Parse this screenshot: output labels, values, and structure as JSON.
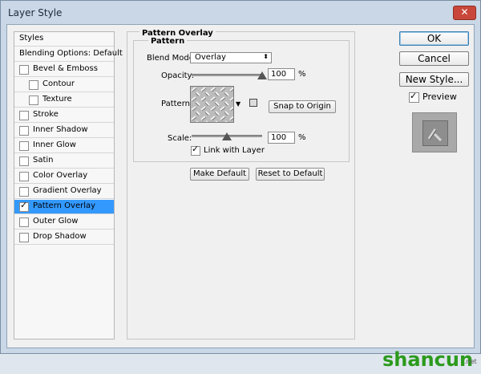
{
  "window": {
    "title": "Layer Style",
    "close_glyph": "✕"
  },
  "styles_list": {
    "items": [
      {
        "label": "Styles",
        "checkbox": false,
        "checked": false,
        "indent": 0
      },
      {
        "label": "Blending Options: Default",
        "checkbox": false,
        "checked": false,
        "indent": 0
      },
      {
        "label": "Bevel & Emboss",
        "checkbox": true,
        "checked": false,
        "indent": 0
      },
      {
        "label": "Contour",
        "checkbox": true,
        "checked": false,
        "indent": 1
      },
      {
        "label": "Texture",
        "checkbox": true,
        "checked": false,
        "indent": 1
      },
      {
        "label": "Stroke",
        "checkbox": true,
        "checked": false,
        "indent": 0
      },
      {
        "label": "Inner Shadow",
        "checkbox": true,
        "checked": false,
        "indent": 0
      },
      {
        "label": "Inner Glow",
        "checkbox": true,
        "checked": false,
        "indent": 0
      },
      {
        "label": "Satin",
        "checkbox": true,
        "checked": false,
        "indent": 0
      },
      {
        "label": "Color Overlay",
        "checkbox": true,
        "checked": false,
        "indent": 0
      },
      {
        "label": "Gradient Overlay",
        "checkbox": true,
        "checked": false,
        "indent": 0
      },
      {
        "label": "Pattern Overlay",
        "checkbox": true,
        "checked": true,
        "indent": 0,
        "selected": true
      },
      {
        "label": "Outer Glow",
        "checkbox": true,
        "checked": false,
        "indent": 0
      },
      {
        "label": "Drop Shadow",
        "checkbox": true,
        "checked": false,
        "indent": 0
      }
    ]
  },
  "panel": {
    "group_title": "Pattern Overlay",
    "subgroup_title": "Pattern",
    "blend_mode_label": "Blend Mode:",
    "blend_mode_value": "Overlay",
    "opacity_label": "Opacity:",
    "opacity_value": "100",
    "opacity_unit": "%",
    "opacity_level": 1.0,
    "pattern_label": "Pattern:",
    "snap_button": "Snap to Origin",
    "scale_label": "Scale:",
    "scale_value": "100",
    "scale_unit": "%",
    "link_label": "Link with Layer",
    "link_checked": true,
    "make_default_button": "Make Default",
    "reset_default_button": "Reset to Default"
  },
  "side": {
    "ok_button": "OK",
    "cancel_button": "Cancel",
    "new_style_button": "New Style...",
    "preview_label": "Preview",
    "preview_checked": true
  },
  "watermark": {
    "text": "shancun",
    "sub": ".net"
  },
  "colors": {
    "selected_row": "#3399ff",
    "accent_green": "#2c9a1d"
  },
  "check_glyph": "✓"
}
